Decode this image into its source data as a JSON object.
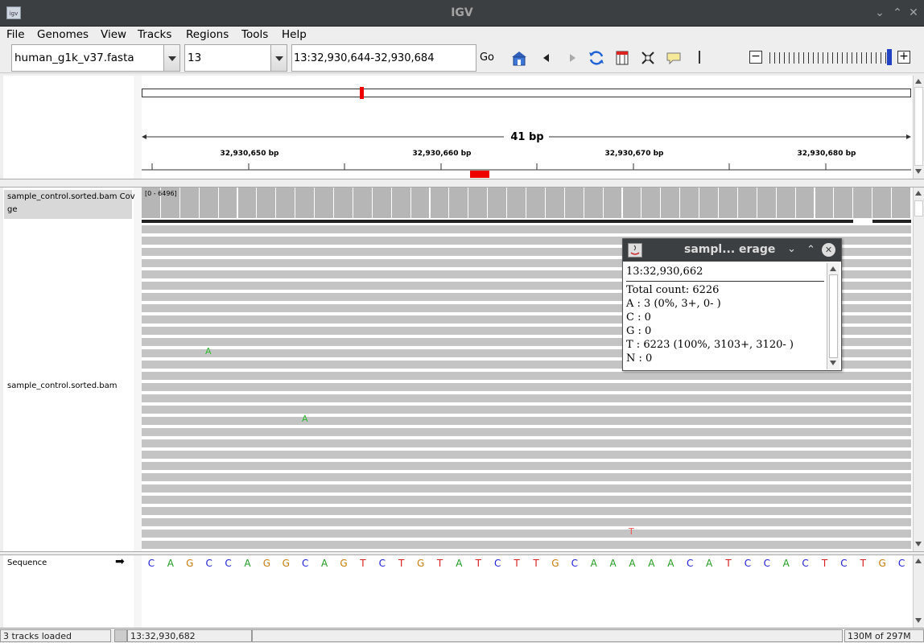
{
  "window": {
    "title": "IGV"
  },
  "menu": [
    "File",
    "Genomes",
    "View",
    "Tracks",
    "Regions",
    "Tools",
    "Help"
  ],
  "toolbar": {
    "genome": "human_g1k_v37.fasta",
    "chromosome": "13",
    "locus": "13:32,930,644-32,930,684",
    "go_label": "Go",
    "zoom_level_fraction": 0.98
  },
  "ruler": {
    "span_label": "41 bp",
    "ticks": [
      "32,930,650 bp",
      "32,930,660 bp",
      "32,930,670 bp",
      "32,930,680 bp"
    ]
  },
  "tracks": {
    "coverage_name": "sample_control.sorted.bam Coverage",
    "coverage_name_line1": "sample_control.sorted.bam Cov",
    "coverage_name_line2": "ge",
    "coverage_scale": "[0 - 6496]",
    "alignment_name": "sample_control.sorted.bam",
    "sequence_name": "Sequence",
    "sequence_arrow": "➡",
    "mismatches": [
      "A",
      "A",
      "T"
    ]
  },
  "sequence": [
    "C",
    "A",
    "G",
    "C",
    "C",
    "A",
    "G",
    "G",
    "C",
    "A",
    "G",
    "T",
    "C",
    "T",
    "G",
    "T",
    "A",
    "T",
    "C",
    "T",
    "T",
    "G",
    "C",
    "A",
    "A",
    "A",
    "A",
    "A",
    "C",
    "A",
    "T",
    "C",
    "C",
    "A",
    "C",
    "T",
    "C",
    "T",
    "G",
    "C"
  ],
  "base_colors": {
    "A": "#1f9a1f",
    "C": "#1c1cd6",
    "G": "#c57c0a",
    "T": "#d42020"
  },
  "popup": {
    "title": "sampl... erage",
    "position": "13:32,930,662",
    "total": "Total count: 6226",
    "a": "A : 3 (0%, 3+, 0- )",
    "c": "C : 0",
    "g": "G : 0",
    "t": "T : 6223 (100%, 3103+, 3120- )",
    "n": "N : 0"
  },
  "status": {
    "tracks_loaded": "3 tracks loaded",
    "position": "13:32,930,682",
    "memory": "130M of 297M"
  }
}
